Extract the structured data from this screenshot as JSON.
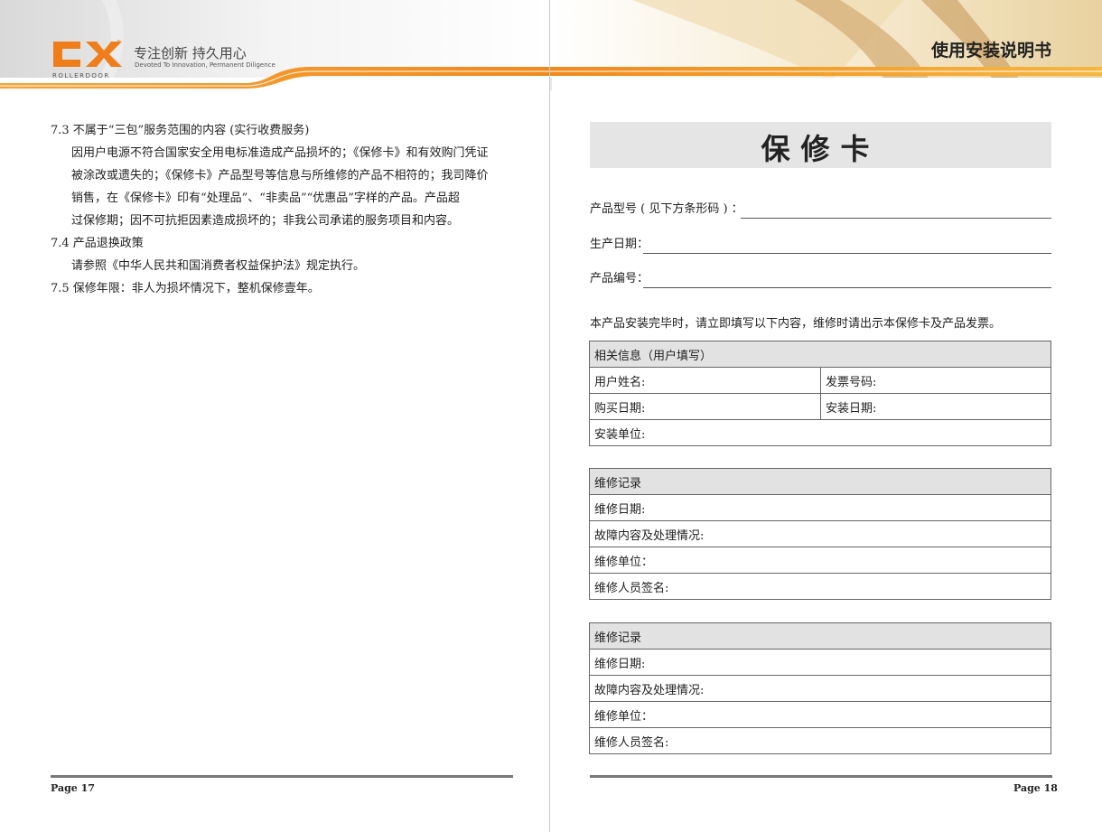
{
  "header": {
    "logo_text": "CX",
    "logo_sub": "ROLLERDOOR",
    "slogan": "专注创新  持久用心",
    "slogan_en": "Devoted To Innovation, Permanent Diligence",
    "manual_title": "使用安装说明书",
    "colors": {
      "accent_orange": "#f08a1c",
      "accent_gold": "#e8b64a"
    }
  },
  "left_page": {
    "lines": [
      "7.3  不属于“三包”服务范围的内容 (实行收费服务)",
      "因用户电源不符合国家安全用电标准造成产品损坏的；《保修卡》和有效购门凭证",
      "被涂改或遗失的；《保修卡》产品型号等信息与所维修的产品不相符的；我司降价",
      "销售，在《保修卡》印有“处理品”、“非卖品”“优惠品”字样的产品。产品超",
      "过保修期；因不可抗拒因素造成损坏的；非我公司承诺的服务项目和内容。",
      "7.4  产品退换政策",
      "请参照《中华人民共和国消费者权益保护法》规定执行。",
      "7.5  保修年限：非人为损坏情况下，整机保修壹年。"
    ],
    "page_number": "Page 17"
  },
  "right_page": {
    "card_title": "保修卡",
    "fields": {
      "model": "产品型号 ( 见下方条形码 ) ：",
      "production_date": "生产日期：",
      "serial": "产品编号："
    },
    "note": "本产品安装完毕时，请立即填写以下内容，维修时请出示本保修卡及产品发票。",
    "user_info": {
      "header": "相关信息（用户填写）",
      "user_name": "用户姓名:",
      "invoice_no": "发票号码:",
      "purchase_date": "购买日期:",
      "install_date": "安装日期:",
      "install_unit": "安装单位:"
    },
    "repair_1": {
      "header": "维修记录",
      "date": "维修日期:",
      "fault": "故障内容及处理情况:",
      "unit": "维修单位：",
      "signature": "维修人员签名:"
    },
    "repair_2": {
      "header": "维修记录",
      "date": "维修日期:",
      "fault": "故障内容及处理情况:",
      "unit": "维修单位：",
      "signature": "维修人员签名:"
    },
    "page_number": "Page 18"
  }
}
